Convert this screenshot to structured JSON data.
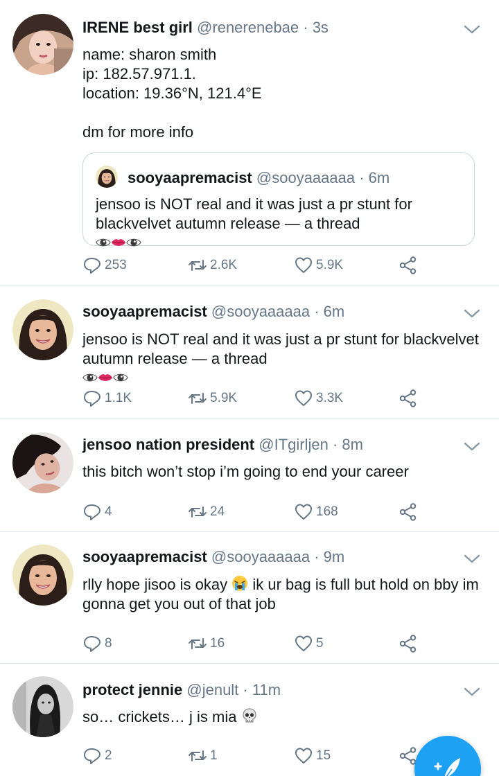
{
  "colors": {
    "accent": "#1da1f2",
    "muted": "#657786",
    "divider": "#e1e8ed"
  },
  "tweets": [
    {
      "name": "IRENE best girl",
      "handle": "@renerenebae · 3s",
      "text": "name: sharon smith\nip: 182.57.971.1.\nlocation: 19.36°N, 121.4°E\n\ndm for more info",
      "quote": {
        "name": "sooyaapremacist",
        "handle": "@sooyaaaaaa · 6m",
        "text": "jensoo is NOT real and it was just a pr stunt for blackvelvet autumn release — a thread"
      },
      "replies": "253",
      "retweets": "2.6K",
      "likes": "5.9K"
    },
    {
      "name": "sooyaapremacist",
      "handle": "@sooyaaaaaa · 6m",
      "text": "jensoo is NOT real and it was just a pr stunt for blackvelvet autumn release — a thread",
      "replies": "1.1K",
      "retweets": "5.9K",
      "likes": "3.3K"
    },
    {
      "name": "jensoo nation president",
      "handle": "@ITgirljen · 8m",
      "text": "this bitch won’t stop i’m going to end your career",
      "replies": "4",
      "retweets": "24",
      "likes": "168"
    },
    {
      "name": "sooyaapremacist",
      "handle": "@sooyaaaaaa · 9m",
      "text_before": "rlly hope jisoo is okay",
      "text_after": "ik ur bag is full but hold on bby im gonna get you out of that job",
      "replies": "8",
      "retweets": "16",
      "likes": "5"
    },
    {
      "name": "protect jennie",
      "handle": "@jenult · 11m",
      "text": "so… crickets… j is mia",
      "replies": "2",
      "retweets": "1",
      "likes": "15"
    }
  ],
  "icons": {
    "reply": "reply-icon",
    "retweet": "retweet-icon",
    "like": "heart-icon",
    "share": "share-icon",
    "caret": "chevron-down-icon",
    "compose": "compose-tweet-icon"
  }
}
